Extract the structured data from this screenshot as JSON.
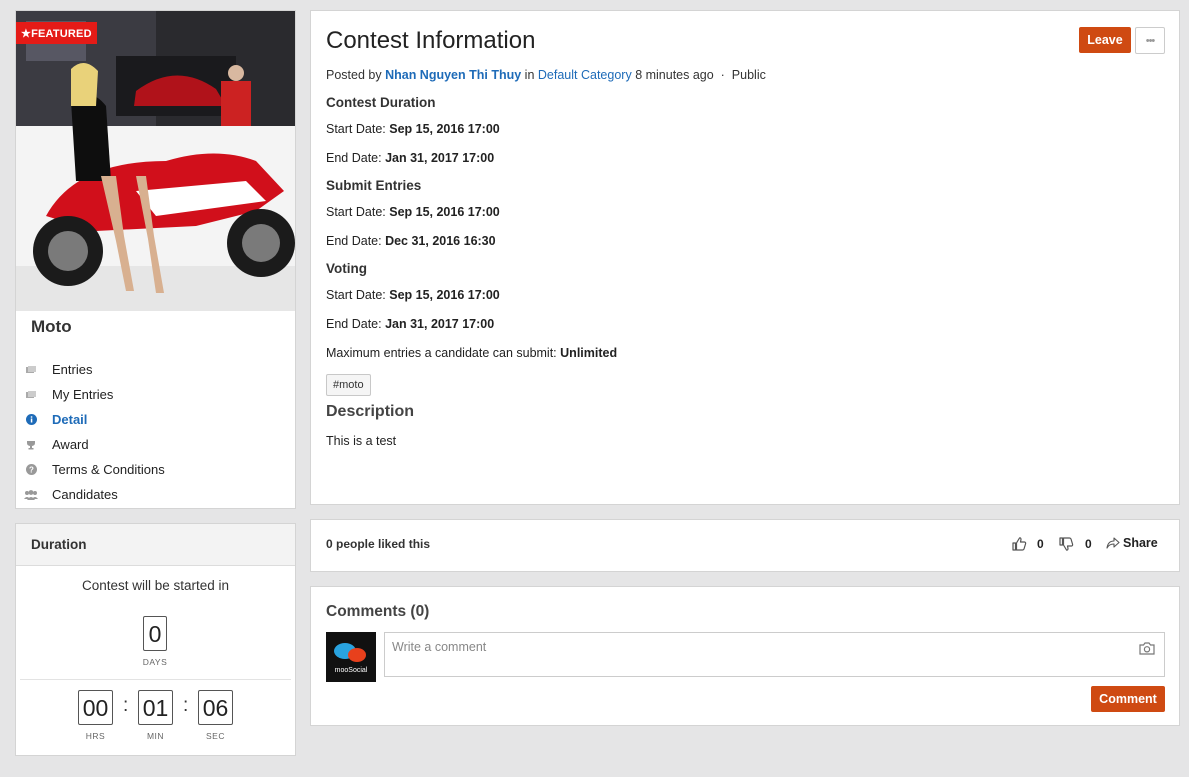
{
  "contest": {
    "featured_label": "FEATURED",
    "name": "Moto",
    "image_subject": "motorcycle-photo",
    "menu": [
      {
        "label": "Entries",
        "icon": "entries-icon",
        "active": false
      },
      {
        "label": "My Entries",
        "icon": "my-entries-icon",
        "active": false
      },
      {
        "label": "Detail",
        "icon": "info-icon",
        "active": true
      },
      {
        "label": "Award",
        "icon": "trophy-icon",
        "active": false
      },
      {
        "label": "Terms & Conditions",
        "icon": "question-icon",
        "active": false
      },
      {
        "label": "Candidates",
        "icon": "users-icon",
        "active": false
      }
    ]
  },
  "duration": {
    "header": "Duration",
    "caption": "Contest will be started in",
    "days": "0",
    "days_label": "DAYS",
    "hours": "00",
    "hours_label": "HRS",
    "minutes": "01",
    "minutes_label": "MIN",
    "seconds": "06",
    "seconds_label": "SEC",
    "separator": ":"
  },
  "info": {
    "title": "Contest Information",
    "leave_label": "Leave",
    "more_label": "•••",
    "posted_by_prefix": "Posted by",
    "author": "Nhan Nguyen Thi Thuy",
    "in_word": "in",
    "category": "Default Category",
    "time_ago": "8 minutes ago",
    "dot": "·",
    "privacy": "Public",
    "start_prefix": "Start Date:",
    "end_prefix": "End Date:",
    "sections": [
      {
        "heading": "Contest Duration",
        "start": "Sep 15, 2016 17:00",
        "end": "Jan 31, 2017 17:00"
      },
      {
        "heading": "Submit Entries",
        "start": "Sep 15, 2016 17:00",
        "end": "Dec 31, 2016 16:30"
      },
      {
        "heading": "Voting",
        "start": "Sep 15, 2016 17:00",
        "end": "Jan 31, 2017 17:00"
      }
    ],
    "max_entries_label": "Maximum entries a candidate can submit:",
    "max_entries_value": "Unlimited",
    "tag": "#moto",
    "description_heading": "Description",
    "description_text": "This is a test"
  },
  "likes": {
    "text": "0 people liked this",
    "like_count": "0",
    "dislike_count": "0",
    "share_label": "Share"
  },
  "comments": {
    "heading": "Comments (0)",
    "placeholder": "Write a comment",
    "submit_label": "Comment",
    "avatar_brand": "mooSocial"
  },
  "colors": {
    "accent": "#cf4a12",
    "link": "#1e6bb8",
    "featured": "#e41b17"
  }
}
